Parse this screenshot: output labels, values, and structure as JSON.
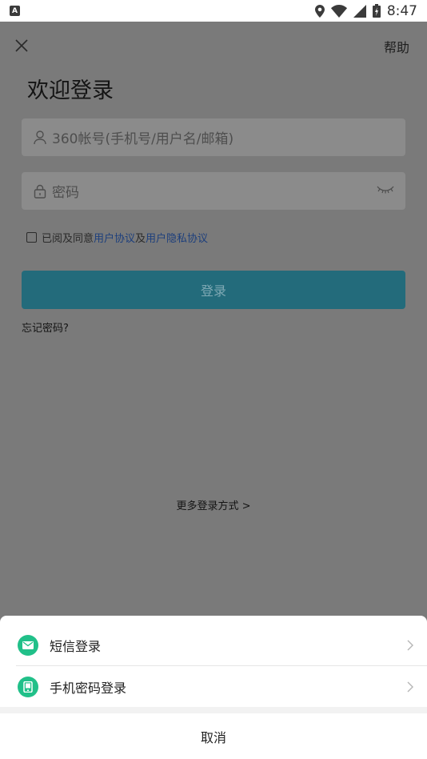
{
  "status_bar": {
    "time": "8:47"
  },
  "header": {
    "help_label": "帮助"
  },
  "title": "欢迎登录",
  "form": {
    "account_placeholder": "360帐号(手机号/用户名/邮箱)",
    "password_placeholder": "密码"
  },
  "agreement": {
    "prefix": "已阅及同意",
    "link_user": "用户协议",
    "conj": "及",
    "link_privacy": "用户隐私协议"
  },
  "login_button": "登录",
  "forgot_password": "忘记密码?",
  "more_login": "更多登录方式 >",
  "sheet": {
    "items": [
      {
        "label": "短信登录",
        "icon": "envelope-icon"
      },
      {
        "label": "手机密码登录",
        "icon": "phone-icon"
      }
    ],
    "cancel_label": "取消"
  },
  "colors": {
    "accent": "#21c089",
    "login_button": "#236b7b",
    "overlay": "#7a7a7a"
  }
}
